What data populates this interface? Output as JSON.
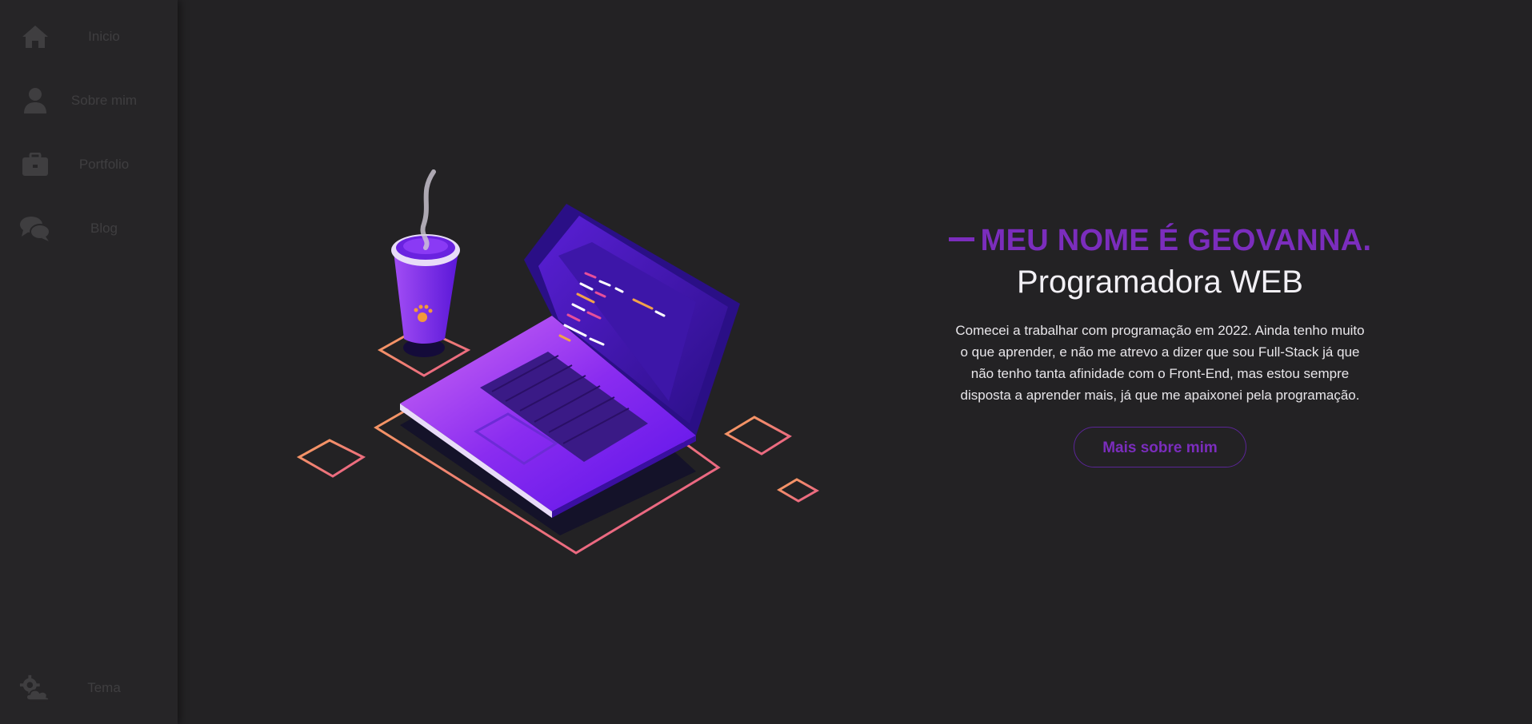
{
  "sidebar": {
    "items": [
      {
        "label": "Inicio",
        "icon": "home-icon"
      },
      {
        "label": "Sobre mim",
        "icon": "user-icon"
      },
      {
        "label": "Portfolio",
        "icon": "briefcase-icon"
      },
      {
        "label": "Blog",
        "icon": "comments-icon"
      }
    ],
    "theme": {
      "label": "Tema",
      "icon": "theme-cloud-gear-icon"
    }
  },
  "hero": {
    "name": "MEU NOME É GEOVANNA.",
    "role": "Programadora WEB",
    "bio": "Comecei a trabalhar com programação em 2022. Ainda tenho muito o que aprender, e não me atrevo a dizer que sou Full-Stack já que não tenho tanta afinidade com o Front-End, mas estou sempre disposta a aprender mais, já que me apaixonei pela programação.",
    "cta_label": "Mais sobre mim"
  },
  "colors": {
    "background": "#232224",
    "sidebar": "#262527",
    "accent": "#7b2dbd",
    "text": "#f2f0f5",
    "muted_icon": "#3f3e40"
  },
  "illustration": {
    "icon": "laptop-coffee-illustration"
  }
}
